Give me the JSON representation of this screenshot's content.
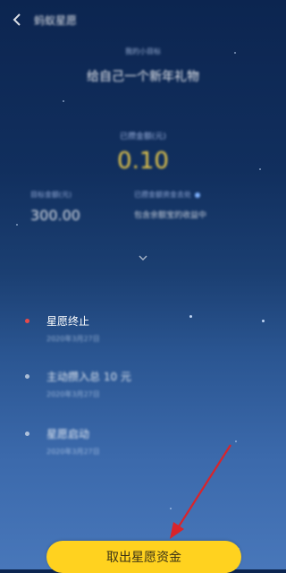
{
  "header": {
    "title": "蚂蚁星愿"
  },
  "wish": {
    "small_label": "我的小目标",
    "title": "给自己一个新年礼物"
  },
  "withdrawable": {
    "label": "已攒金额(元)",
    "value": "0.10"
  },
  "target": {
    "label": "目标金额(元)",
    "value": "300.00"
  },
  "funds": {
    "label": "已攒金额资金去处",
    "description": "包含余额宝的收益中"
  },
  "timeline": [
    {
      "title": "星愿终止",
      "date": "2020年3月27日",
      "active": true
    },
    {
      "title": "主动攒入总 10 元",
      "date": "2020年3月27日",
      "active": false
    },
    {
      "title": "星愿启动",
      "date": "2020年3月27日",
      "active": false
    }
  ],
  "action": {
    "withdraw_label": "取出星愿资金"
  },
  "colors": {
    "accent_yellow": "#ffd21f",
    "amount_gold": "#e9c94a",
    "active_dot": "#e64a4a"
  }
}
